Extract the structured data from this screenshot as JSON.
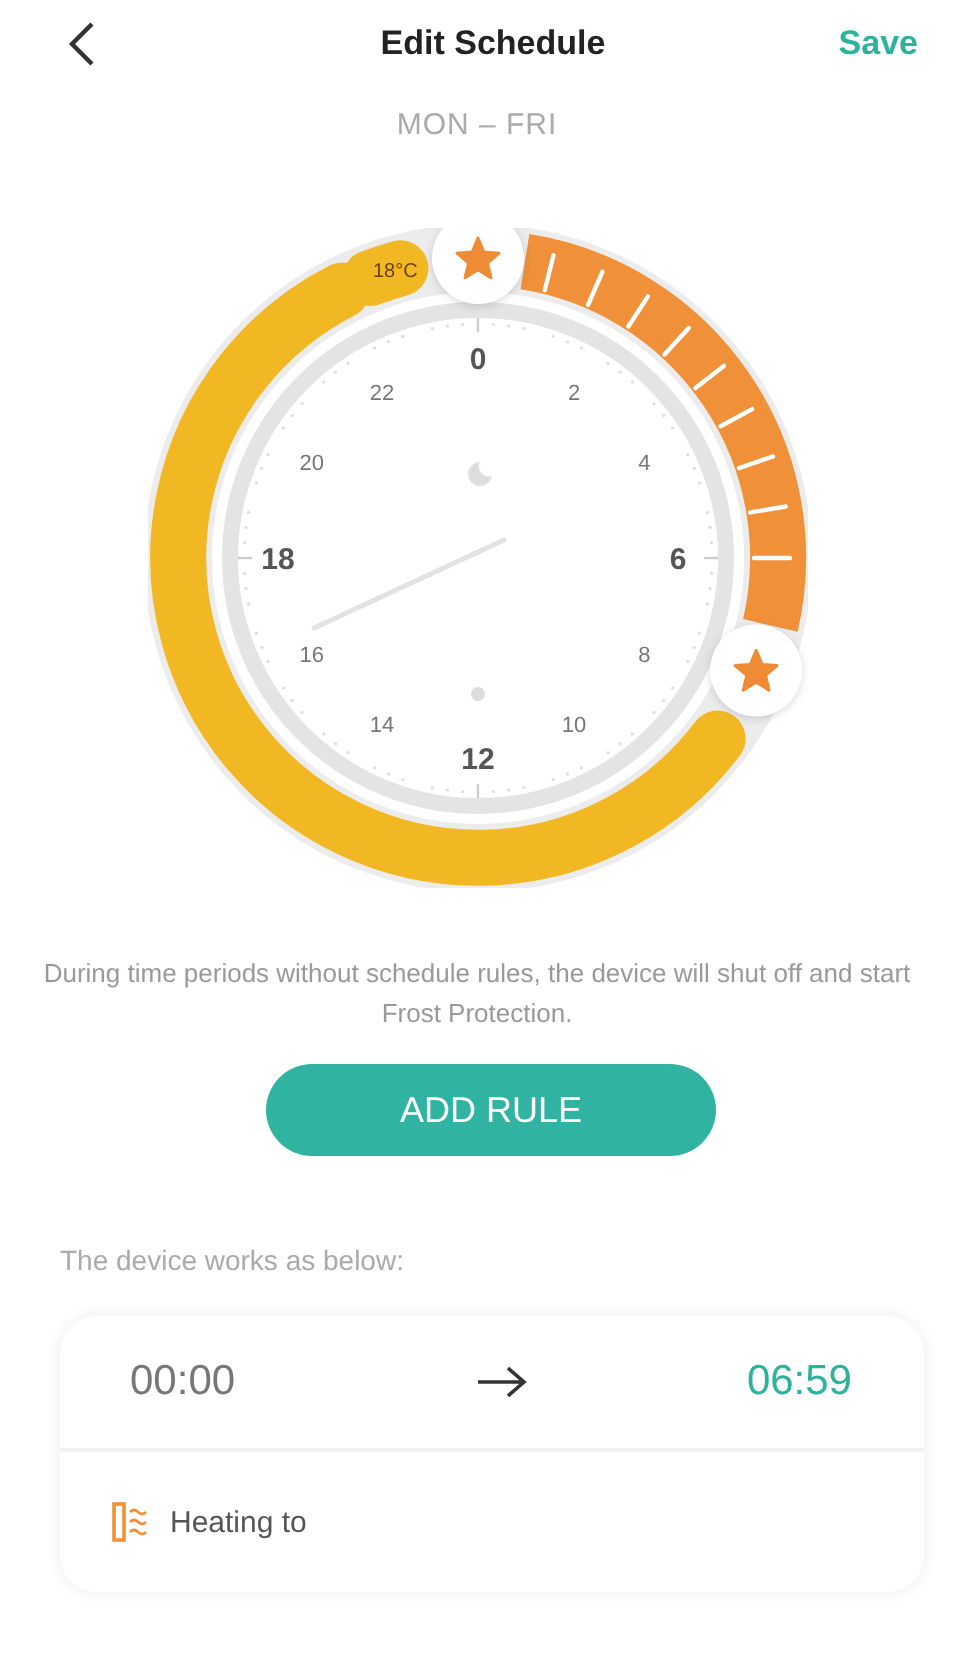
{
  "header": {
    "title": "Edit Schedule",
    "action": "Save"
  },
  "days": "MON – FRI",
  "clock": {
    "segments": [
      {
        "kind": "heating",
        "color": "#f0913a"
      },
      {
        "kind": "eco",
        "color": "#f2b824"
      },
      {
        "kind": "eco",
        "color": "#f2b824",
        "label": "18°C"
      }
    ],
    "hours": [
      "0",
      "2",
      "4",
      "6",
      "8",
      "10",
      "12",
      "14",
      "16",
      "18",
      "20",
      "22"
    ]
  },
  "note": "During time periods without schedule rules, the device will shut off and start Frost Protection.",
  "add_button": "ADD RULE",
  "list_title": "The device works as below:",
  "rules": [
    {
      "from": "00:00",
      "to": "06:59",
      "mode": "Heating to"
    }
  ]
}
